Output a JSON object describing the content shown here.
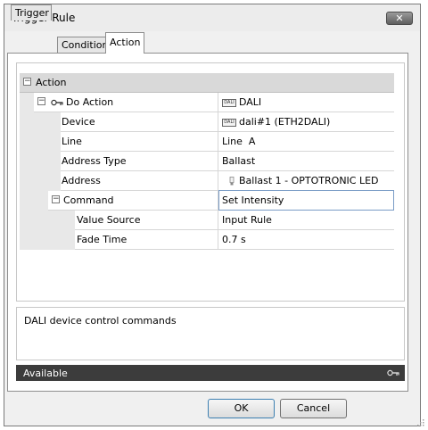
{
  "window": {
    "title": "Trigger Rule",
    "close_glyph": "✕"
  },
  "tabs": [
    {
      "label": "Trigger",
      "active": false
    },
    {
      "label": "Condition",
      "active": false
    },
    {
      "label": "Action",
      "active": true
    }
  ],
  "property_grid": {
    "category": "Action",
    "rows": [
      {
        "label": "Do Action",
        "value": "DALI",
        "label_icon": "key-icon",
        "value_icon": "dali-icon"
      },
      {
        "label": "Device",
        "value": "dali#1 (ETH2DALI)",
        "value_icon": "dali-icon"
      },
      {
        "label": "Line",
        "value": "Line  A"
      },
      {
        "label": "Address Type",
        "value": "Ballast"
      },
      {
        "label": "Address",
        "value": "Ballast 1 - OPTOTRONIC LED",
        "value_icon": "lamp-icon"
      },
      {
        "label": "Command",
        "value": "Set Intensity"
      },
      {
        "label": "Value Source",
        "value": "Input Rule"
      },
      {
        "label": "Fade Time",
        "value": "0.7 s"
      }
    ],
    "collapse_glyph": "−",
    "dali_icon_text": "DALI"
  },
  "description": "DALI device control commands",
  "status": {
    "text": "Available",
    "icon": "key-icon"
  },
  "buttons": {
    "ok": "OK",
    "cancel": "Cancel"
  },
  "colors": {
    "status_bar": "#3c3c3c",
    "category_row": "#d9d9d9"
  }
}
